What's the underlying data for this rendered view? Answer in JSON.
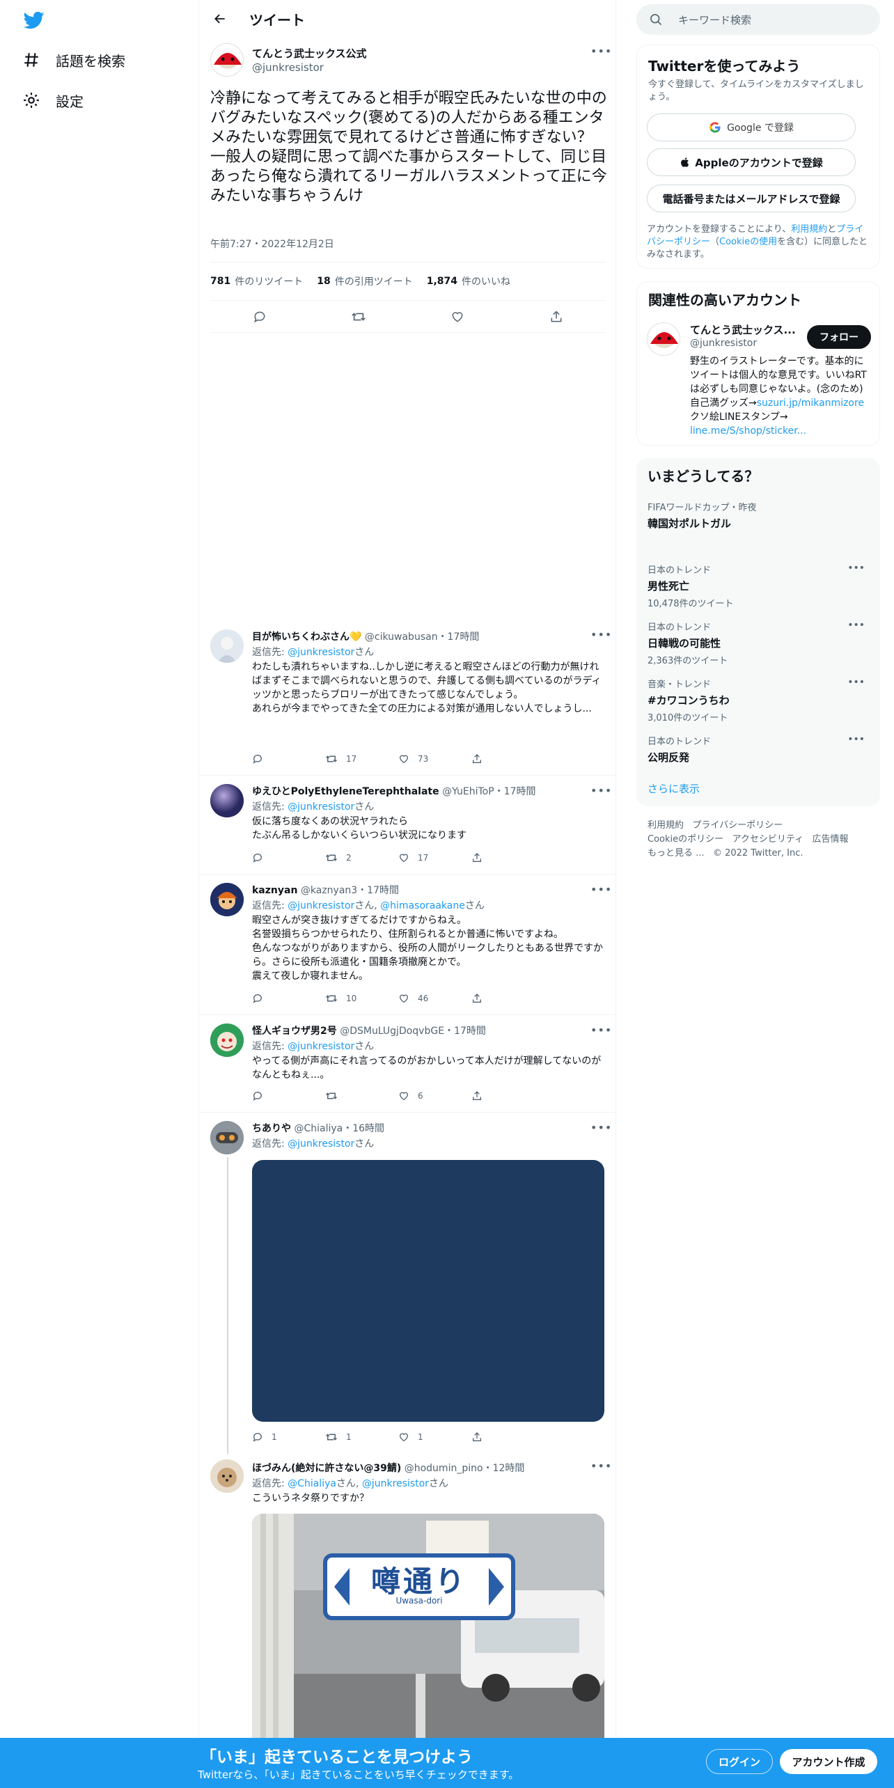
{
  "nav": {
    "explore_label": "話題を検索",
    "settings_label": "設定"
  },
  "header": {
    "title": "ツイート"
  },
  "main_tweet": {
    "name": "てんとう武士ックス公式",
    "handle": "@junkresistor",
    "text": "冷静になって考えてみると相手が暇空氏みたいな世の中のバグみたいなスペック(褒めてる)の人だからある種エンタメみたいな雰囲気で見れてるけどさ普通に怖すぎない？一般人の疑問に思って調べた事からスタートして、同じ目あったら俺なら潰れてるリーガルハラスメントって正に今みたいな事ちゃうんけ",
    "date": "午前7:27・2022年12月2日",
    "retweets": "781",
    "retweets_label": "件のリツイート",
    "quotes": "18",
    "quotes_label": "件の引用ツイート",
    "likes": "1,874",
    "likes_label": "件のいいね"
  },
  "reply_prefix": "返信先: ",
  "reply_suffix": "さん",
  "replies": [
    {
      "name": "目が怖いちくわぶさん💛",
      "handle": "@cikuwabusan",
      "time": "・17時間",
      "to": "@junkresistor",
      "text": "わたしも潰れちゃいますね..しかし逆に考えると暇空さんほどの行動力が無ければまずそこまで調べられないと思うので、弁護してる側も調べているのがラディッツかと思ったらブロリーが出てきたって感じなんでしょう。\nあれらが今までやってきた全ての圧力による対策が通用しない人でしょうし...",
      "replies_count": "",
      "retweets": "17",
      "likes": "73"
    },
    {
      "name": "ゆえひとPolyEthyleneTerephthalate",
      "handle": "@YuEhiToP",
      "time": "・17時間",
      "to": "@junkresistor",
      "text": "仮に落ち度なくあの状況ヤラれたら\nたぶん吊るしかないくらいつらい状況になります",
      "replies_count": "",
      "retweets": "2",
      "likes": "17"
    },
    {
      "name": "kaznyan",
      "handle": "@kaznyan3",
      "time": "・17時間",
      "to": "@junkresistor",
      "to2": "@himasoraakane",
      "text": "暇空さんが突き抜けすぎてるだけですからねえ。\n名誉毀損ちらつかせられたり、住所割られるとか普通に怖いですよね。\n色んなつながりがありますから、役所の人間がリークしたりともある世界ですから。さらに役所も派遣化・国籍条項撤廃とかで。\n震えて夜しか寝れません。",
      "replies_count": "",
      "retweets": "10",
      "likes": "46"
    },
    {
      "name": "怪人ギョウザ男2号",
      "handle": "@DSMuLUgjDoqvbGE",
      "time": "・17時間",
      "to": "@junkresistor",
      "text": "やってる側が声高にそれ言ってるのがおかしいって本人だけが理解してないのがなんともねぇ...。",
      "replies_count": "",
      "retweets": "",
      "likes": "6"
    },
    {
      "name": "ちありや",
      "handle": "@Chialiya",
      "time": "・16時間",
      "to": "@junkresistor",
      "text": "",
      "replies_count": "1",
      "retweets": "1",
      "likes": "1"
    },
    {
      "name": "ほづみん(絶対に許さない@39鯖)",
      "handle": "@hodumin_pino",
      "time": "・12時間",
      "to": "@Chialiya",
      "to2": "@junkresistor",
      "text": "こういうネタ祭りですか？",
      "sign_text": "噂通り",
      "sign_sub": "Uwasa-dori"
    }
  ],
  "right": {
    "search_placeholder": "キーワード検索",
    "signup_card": {
      "title": "Twitterを使ってみよう",
      "subtitle": "今すぐ登録して、タイムラインをカスタマイズしましょう。",
      "google_btn": "Google で登録",
      "apple_btn": "Appleのアカウントで登録",
      "phone_btn": "電話番号またはメールアドレスで登録",
      "terms_1": "アカウントを登録することにより、",
      "terms_link_1": "利用規約",
      "terms_2": "と",
      "terms_link_2": "プライバシーポリシー",
      "terms_3": "（",
      "terms_link_3": "Cookieの使用",
      "terms_4": "を含む）に同意したとみなされます。"
    },
    "related": {
      "title": "関連性の高いアカウント",
      "name": "てんとう武士ックス...",
      "handle": "@junkresistor",
      "follow": "フォロー",
      "bio_1": "野生のイラストレーターです。基本的にツイートは個人的な意見です。いいねRTは必ずしも同意じゃないよ。(念のため) 自己満グッズ→",
      "bio_link_1": "suzuri.jp/mikanmizore",
      "bio_2": "クソ絵LINEスタンプ→ ",
      "bio_link_2": "line.me/S/shop/sticker..."
    },
    "trends": {
      "title": "いまどうしてる？",
      "items": [
        {
          "cat": "FIFAワールドカップ・昨夜",
          "title": "韓国対ポルトガル",
          "count": ""
        },
        {
          "cat": "日本のトレンド",
          "title": "男性死亡",
          "count": "10,478件のツイート"
        },
        {
          "cat": "日本のトレンド",
          "title": "日韓戦の可能性",
          "count": "2,363件のツイート"
        },
        {
          "cat": "音楽・トレンド",
          "title": "#カワコンうちわ",
          "count": "3,010件のツイート"
        },
        {
          "cat": "日本のトレンド",
          "title": "公明反発",
          "count": ""
        }
      ],
      "show_more": "さらに表示"
    },
    "footer": {
      "terms": "利用規約",
      "privacy": "プライバシーポリシー",
      "cookie": "Cookieのポリシー",
      "accessibility": "アクセシビリティ",
      "ads": "広告情報",
      "more": "もっと見る ...",
      "copyright": "© 2022 Twitter, Inc."
    }
  },
  "bottom": {
    "headline": "「いま」起きていることを見つけよう",
    "sub": "Twitterなら、「いま」起きていることをいち早くチェックできます。",
    "login": "ログイン",
    "signup": "アカウント作成"
  },
  "colors": {
    "accent": "#1d9bf0",
    "text": "#0f1419",
    "muted": "#536471",
    "image_placeholder": "#1e3a5f"
  }
}
